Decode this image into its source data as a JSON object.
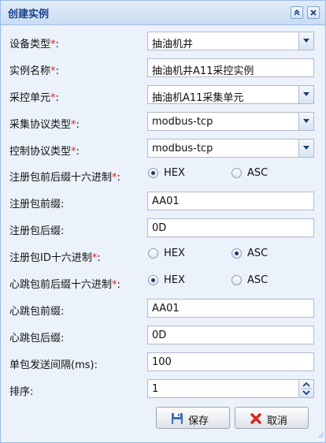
{
  "panel": {
    "title": "创建实例",
    "collapse_icon": "double-chevron-up-icon",
    "close_icon": "close-icon"
  },
  "fields": {
    "device_type": {
      "label": "设备类型",
      "required": "*",
      "value": "抽油机井"
    },
    "instance_name": {
      "label": "实例名称",
      "required": "*",
      "value": "抽油机井A11采控实例"
    },
    "control_unit": {
      "label": "采控单元",
      "required": "*",
      "value": "抽油机A11采集单元"
    },
    "acq_protocol": {
      "label": "采集协议类型",
      "required": "*",
      "value": "modbus-tcp"
    },
    "ctrl_protocol": {
      "label": "控制协议类型",
      "required": "*",
      "value": "modbus-tcp"
    },
    "reg_prefix_suffix_hex": {
      "label": "注册包前后缀十六进制",
      "required": "*",
      "options": [
        "HEX",
        "ASC"
      ],
      "selected": "HEX"
    },
    "reg_prefix": {
      "label": "注册包前缀:",
      "value": "AA01"
    },
    "reg_suffix": {
      "label": "注册包后缀:",
      "value": "0D"
    },
    "reg_id_hex": {
      "label": "注册包ID十六进制",
      "required": "*",
      "options": [
        "HEX",
        "ASC"
      ],
      "selected": "ASC"
    },
    "hb_prefix_suffix_hex": {
      "label": "心跳包前后缀十六进制",
      "required": "*",
      "options": [
        "HEX",
        "ASC"
      ],
      "selected": "HEX"
    },
    "hb_prefix": {
      "label": "心跳包前缀:",
      "value": "AA01"
    },
    "hb_suffix": {
      "label": "心跳包后缀:",
      "value": "0D"
    },
    "send_interval": {
      "label": "单包发送间隔(ms):",
      "value": "100"
    },
    "sort": {
      "label": "排序:",
      "value": "1"
    }
  },
  "buttons": {
    "save": "保存",
    "cancel": "取消"
  },
  "colors": {
    "header_text": "#15428b",
    "required": "#e02020",
    "panel_bg": "#ebf2fb",
    "border": "#99bbe8"
  }
}
